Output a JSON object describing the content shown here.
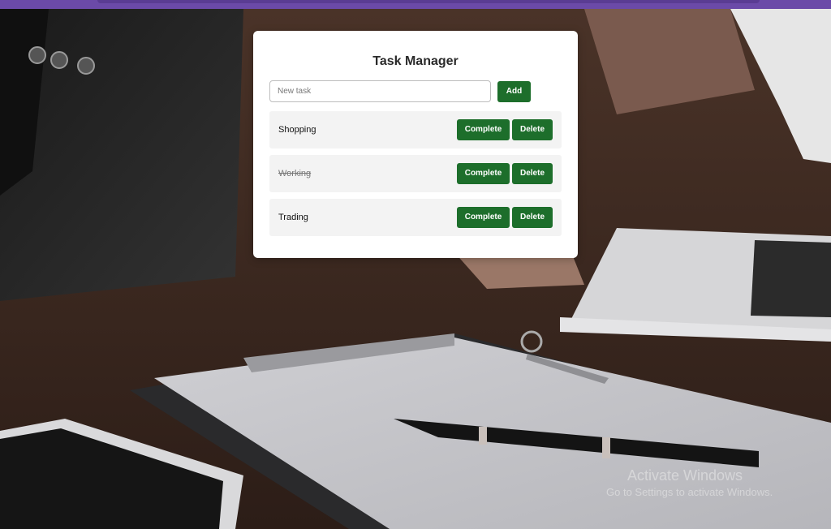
{
  "app": {
    "title": "Task Manager"
  },
  "input": {
    "placeholder": "New task",
    "value": ""
  },
  "add_button_label": "Add",
  "tasks": [
    {
      "label": "Shopping",
      "completed": false,
      "complete_label": "Complete",
      "delete_label": "Delete"
    },
    {
      "label": "Working",
      "completed": true,
      "complete_label": "Complete",
      "delete_label": "Delete"
    },
    {
      "label": "Trading",
      "completed": false,
      "complete_label": "Complete",
      "delete_label": "Delete"
    }
  ],
  "watermark": {
    "line1": "Activate Windows",
    "line2": "Go to Settings to activate Windows."
  },
  "colors": {
    "accent": "#1d6e2b",
    "topbar": "#6b4aa8",
    "card_bg": "#ffffff",
    "row_bg": "#f3f3f3"
  }
}
